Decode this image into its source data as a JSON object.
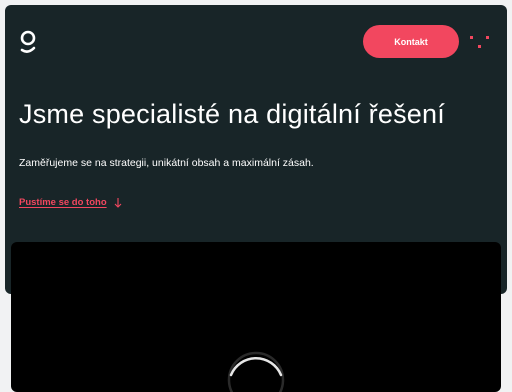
{
  "header": {
    "logo_icon": "brand-g-logo-icon",
    "contact_label": "Kontakt",
    "menu_icon": "dots-menu-icon",
    "accent_color": "#f2475f",
    "background_color": "#182528"
  },
  "hero": {
    "headline": "Jsme specialisté na digitální řešení",
    "subtitle": "Zaměřujeme se na strategii, unikátní obsah a maximální zásah.",
    "cta_label": "Pustíme se do toho",
    "cta_icon": "arrow-down-icon"
  },
  "video": {
    "background_color": "#000000",
    "loading_icon": "spinner-icon"
  }
}
